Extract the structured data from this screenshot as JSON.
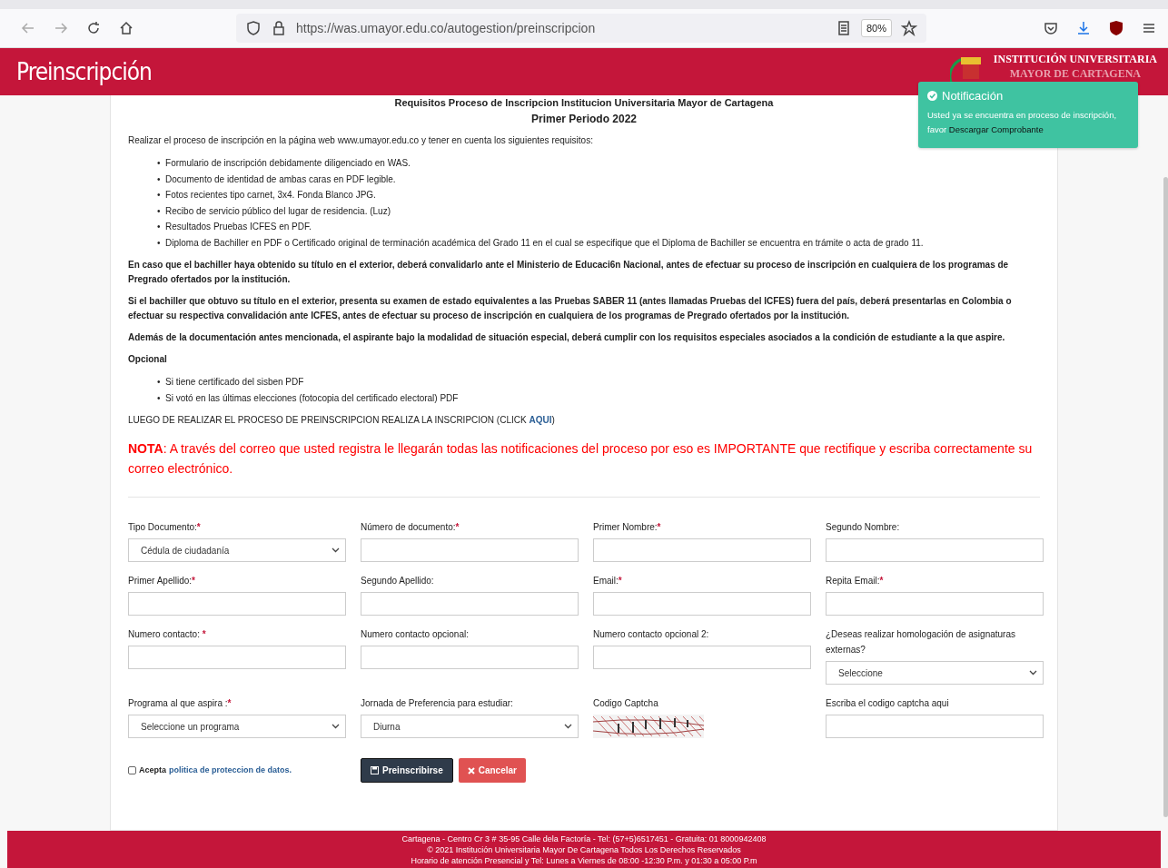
{
  "browser": {
    "url": "https://was.umayor.edu.co/autogestion/preinscripcion",
    "zoom": "80%"
  },
  "header": {
    "title": "Preinscripción",
    "institution_line1": "INSTITUCIÓN UNIVERSITARIA",
    "institution_line2": "MAYOR DE CARTAGENA"
  },
  "notification": {
    "title": "Notificación",
    "text": "Usted ya se encuentra en proceso de inscripción, favor",
    "link": "Descargar Comprobante"
  },
  "requirements": {
    "bullet": "•",
    "heading": "Requisitos Proceso de Inscripcion Institucion Universitaria Mayor de Cartagena",
    "subheading": "Primer Periodo 2022",
    "intro": "Realizar el proceso de inscripción en la página web www.umayor.edu.co y tener en cuenta los siguientes requisitos:",
    "items": [
      "Formulario de inscripción debidamente diligenciado en WAS.",
      "Documento de identidad de ambas caras en PDF legible.",
      "Fotos recientes tipo carnet, 3x4. Fonda Blanco JPG.",
      "Recibo de servicio público del lugar de residencia. (Luz)",
      "Resultados Pruebas ICFES en PDF.",
      "Diploma de Bachiller en PDF o Certificado original de terminación académica del Grado 11 en el cual se especifique que el Diploma de Bachiller se encuentra en trámite o acta de grado 11."
    ],
    "paragraphs": [
      "En caso que el bachiller haya obtenido su título en el exterior, deberá convalidarlo ante el Ministerio de Educaci6n Nacional, antes de efectuar su proceso de inscripción en cualquiera de los programas de Pregrado ofertados por la institución.",
      "Si el bachiller que obtuvo su título en el exterior, presenta su examen de estado equivalentes a las Pruebas SABER 11 (antes llamadas Pruebas del ICFES) fuera del país, deberá presentarlas en Colombia o efectuar su respectiva convalidación ante ICFES, antes de efectuar su proceso de inscripción en cualquiera de los programas de Pregrado ofertados por la institución.",
      "Además de la documentación antes mencionada, el aspirante bajo la modalidad de situación especial, deberá cumplir con los requisitos especiales asociados a la condición de estudiante a la que aspire."
    ],
    "optional_heading": "Opcional",
    "optional_items": [
      "Si tiene certificado del sisben PDF",
      "Si votó en las últimas elecciones (fotocopia del certificado electoral) PDF"
    ],
    "click_text": "LUEGO DE REALIZAR EL PROCESO DE PREINSCRIPCION REALIZA LA INSCRIPCION (CLICK",
    "click_link": "AQUI",
    "click_tail": ")",
    "note": "**NOTA**: A través del correo que usted registra le llegarán todas las notificaciones del proceso por eso es IMPORTANTE que rectifique y escriba correctamente su correo electrónico."
  },
  "form": {
    "required_marker": "*",
    "fields": [
      {
        "label": "Tipo Documento:",
        "required": true,
        "kind": "select",
        "value": "Cédula de ciudadanía"
      },
      {
        "label": "Número de documento:",
        "required": true,
        "kind": "input"
      },
      {
        "label": "Primer Nombre:",
        "required": true,
        "kind": "input"
      },
      {
        "label": "Segundo Nombre:",
        "required": false,
        "kind": "input"
      },
      {
        "label": "Primer Apellido:",
        "required": true,
        "kind": "input"
      },
      {
        "label": "Segundo Apellido:",
        "required": false,
        "kind": "input"
      },
      {
        "label": "Email:",
        "required": true,
        "kind": "input"
      },
      {
        "label": "Repita Email:",
        "required": true,
        "kind": "input"
      },
      {
        "label": "Numero contacto: ",
        "required": true,
        "kind": "input"
      },
      {
        "label": "Numero contacto opcional:",
        "required": false,
        "kind": "input"
      },
      {
        "label": "Numero contacto opcional 2:",
        "required": false,
        "kind": "input"
      },
      {
        "label": "¿Deseas realizar homologación de asignaturas externas?",
        "required": false,
        "kind": "select",
        "value": "Seleccione"
      },
      {
        "label": "Programa al que aspira :",
        "required": true,
        "kind": "select",
        "value": "Seleccione un programa"
      },
      {
        "label": "Jornada de Preferencia para estudiar:",
        "required": false,
        "kind": "select",
        "value": "Diurna"
      },
      {
        "label": "Codigo Captcha",
        "required": false,
        "kind": "captcha"
      },
      {
        "label": "Escriba el codigo captcha aqui",
        "required": false,
        "kind": "input"
      }
    ],
    "consent": {
      "checked": false,
      "label": "Acepta",
      "link": "politica de proteccion de datos."
    },
    "buttons": [
      {
        "label": "Preinscribirse",
        "kind": "primary"
      },
      {
        "label": "Cancelar",
        "kind": "danger"
      }
    ]
  },
  "footer": [
    "Cartagena - Centro Cr 3 # 35-95 Calle dela Factoría - Tel: (57+5)6517451 - Gratuita: 01 8000942408",
    "© 2021 Institución Universitaria Mayor De Cartagena Todos Los Derechos Reservados",
    "Horario de atención Presencial y Tel: Lunes a Viernes de 08:00 -12:30 P.m. y 01:30 a 05:00 P.m"
  ]
}
